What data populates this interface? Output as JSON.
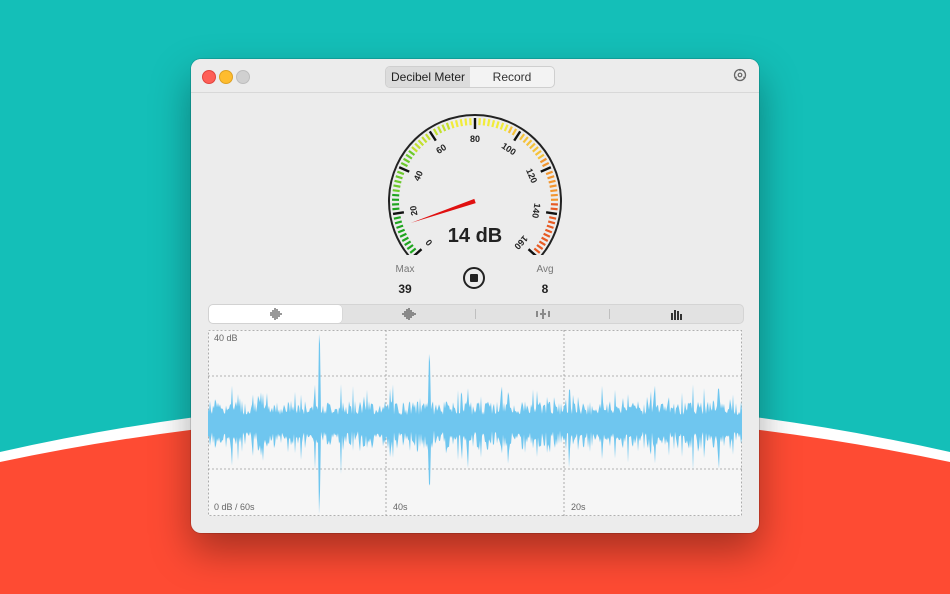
{
  "colors": {
    "background_top": "#14bfb8",
    "background_bottom": "#fe4b33",
    "waveform": "#6fc6ef",
    "needle": "#e01010"
  },
  "window": {
    "tabs": [
      {
        "label": "Decibel Meter",
        "active": true
      },
      {
        "label": "Record",
        "active": false
      }
    ],
    "settings_icon": "gear-icon"
  },
  "gauge": {
    "scale_labels": [
      "0",
      "20",
      "40",
      "60",
      "80",
      "100",
      "120",
      "140",
      "160"
    ],
    "min": 0,
    "max": 160,
    "current_value": 14,
    "readout": "14 dB"
  },
  "stats": {
    "max_label": "Max",
    "max_value": "39",
    "avg_label": "Avg",
    "avg_value": "8"
  },
  "controls": {
    "stop_icon": "stop-icon",
    "modes": [
      {
        "icon": "waveform-narrow-icon",
        "active": true
      },
      {
        "icon": "waveform-wide-icon",
        "active": false
      },
      {
        "icon": "waveform-sparse-icon",
        "active": false
      },
      {
        "icon": "bar-chart-icon",
        "active": false
      }
    ]
  },
  "chart_data": {
    "type": "area",
    "top_label": "40 dB",
    "x_labels": [
      "0 dB / 60s",
      "40s",
      "20s"
    ],
    "ylim": [
      0,
      40
    ],
    "grid": true
  }
}
